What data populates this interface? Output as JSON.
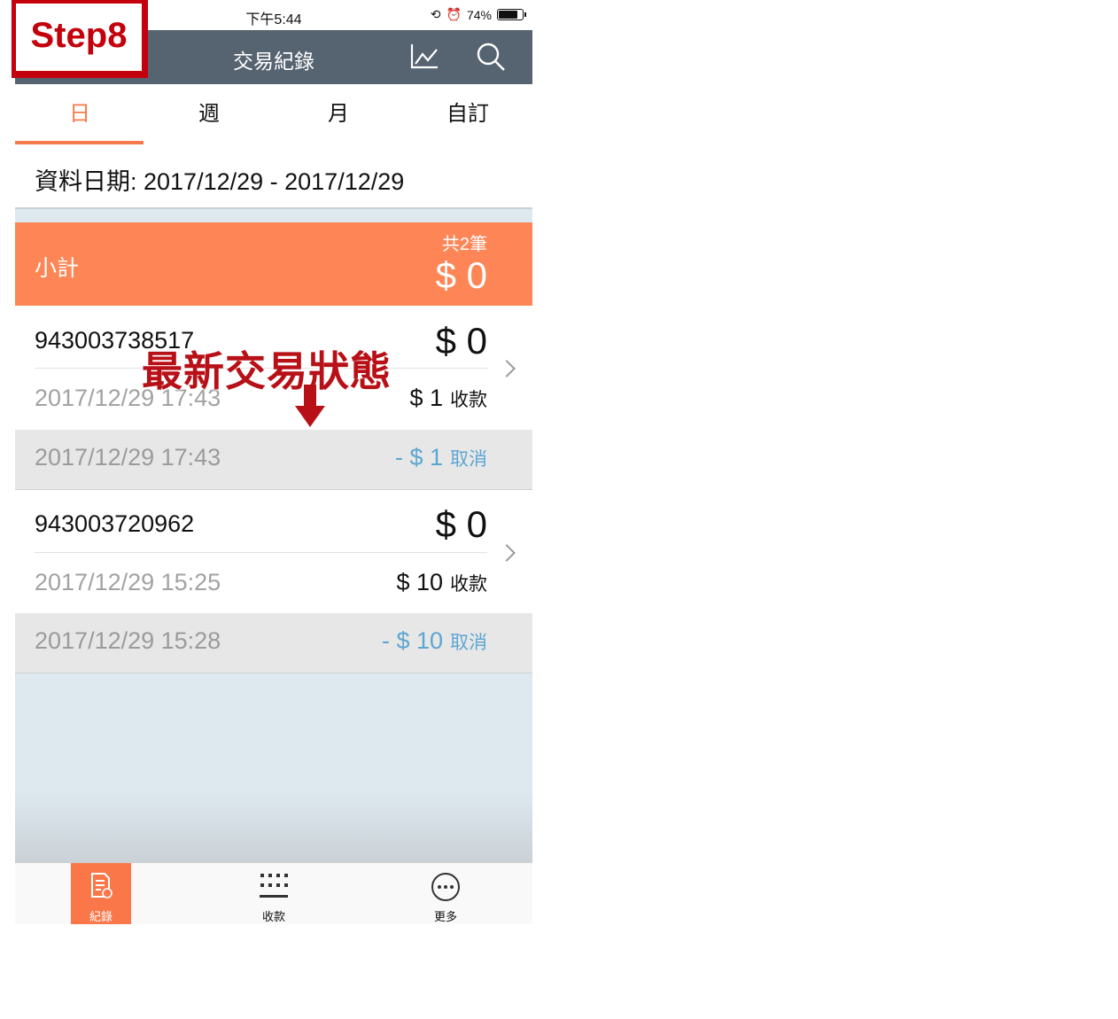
{
  "step_badge": "Step8",
  "status_bar": {
    "time": "下午5:44",
    "battery": "74%",
    "battery_level": 0.74
  },
  "header": {
    "title": "交易紀錄",
    "icons": [
      "chart-icon",
      "search-icon"
    ]
  },
  "tabs": [
    {
      "label": "日",
      "active": true
    },
    {
      "label": "週",
      "active": false
    },
    {
      "label": "月",
      "active": false
    },
    {
      "label": "自訂",
      "active": false
    }
  ],
  "date_range": "資料日期: 2017/12/29 - 2017/12/29",
  "subtotal": {
    "label": "小計",
    "count": "共2筆",
    "amount": "$ 0"
  },
  "transactions": [
    {
      "id": "943003738517",
      "total": "$ 0",
      "charge": {
        "time": "2017/12/29 17:43",
        "amount": "$ 1",
        "action": "收款"
      },
      "cancel": {
        "time": "2017/12/29 17:43",
        "amount": "- $ 1",
        "action": "取消"
      }
    },
    {
      "id": "943003720962",
      "total": "$ 0",
      "charge": {
        "time": "2017/12/29 15:25",
        "amount": "$ 10",
        "action": "收款"
      },
      "cancel": {
        "time": "2017/12/29 15:28",
        "amount": "- $ 10",
        "action": "取消"
      }
    }
  ],
  "annotation": "最新交易狀態",
  "tab_bar": [
    {
      "label": "紀錄",
      "icon": "records-icon",
      "active": true
    },
    {
      "label": "收款",
      "icon": "keypad-icon",
      "active": false
    },
    {
      "label": "更多",
      "icon": "more-icon",
      "active": false
    }
  ],
  "colors": {
    "accent": "#f47a4c",
    "subtotal_bg": "#fe8656",
    "navbar": "#566370",
    "cancel_text": "#5da6d2",
    "badge_red": "#c3000b"
  }
}
